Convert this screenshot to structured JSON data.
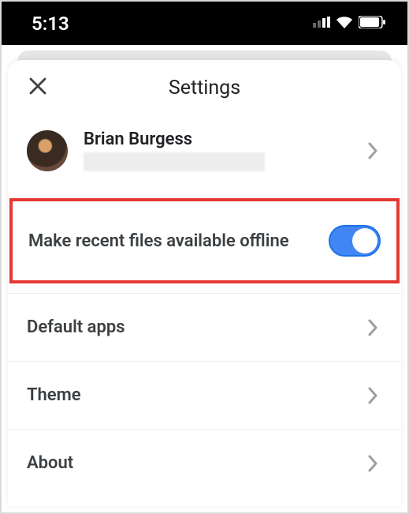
{
  "statusbar": {
    "time": "5:13"
  },
  "header": {
    "title": "Settings"
  },
  "account": {
    "name": "Brian Burgess"
  },
  "offline": {
    "label": "Make recent files available offline",
    "enabled": true
  },
  "rows": {
    "default_apps": "Default apps",
    "theme": "Theme",
    "about": "About"
  }
}
